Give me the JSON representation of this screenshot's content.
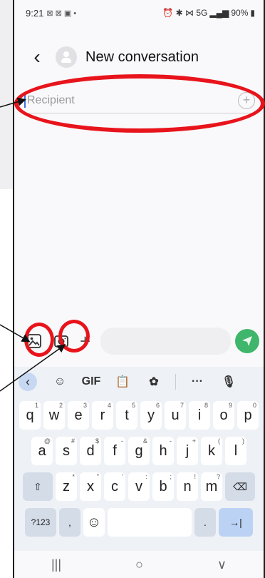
{
  "status_bar": {
    "time": "9:21",
    "notification_icons": "⊠ ⊠ ▣ •",
    "right_icons": "⏰ ✱ ⋈ 5G",
    "battery": "90%"
  },
  "app_bar": {
    "title": "New conversation"
  },
  "recipient": {
    "placeholder": "Recipient",
    "add_label": "+"
  },
  "compose": {
    "plus_label": "+"
  },
  "keyboard": {
    "toolbar": [
      "GIF",
      "···"
    ],
    "row1": [
      {
        "k": "q",
        "h": "1"
      },
      {
        "k": "w",
        "h": "2"
      },
      {
        "k": "e",
        "h": "3"
      },
      {
        "k": "r",
        "h": "4"
      },
      {
        "k": "t",
        "h": "5"
      },
      {
        "k": "y",
        "h": "6"
      },
      {
        "k": "u",
        "h": "7"
      },
      {
        "k": "i",
        "h": "8"
      },
      {
        "k": "o",
        "h": "9"
      },
      {
        "k": "p",
        "h": "0"
      }
    ],
    "row2": [
      {
        "k": "a",
        "h": "@"
      },
      {
        "k": "s",
        "h": "#"
      },
      {
        "k": "d",
        "h": "$"
      },
      {
        "k": "f",
        "h": "-"
      },
      {
        "k": "g",
        "h": "&"
      },
      {
        "k": "h",
        "h": "-"
      },
      {
        "k": "j",
        "h": "+"
      },
      {
        "k": "k",
        "h": "("
      },
      {
        "k": "l",
        "h": ")"
      }
    ],
    "row3": [
      {
        "k": "z",
        "h": "*"
      },
      {
        "k": "x",
        "h": "\""
      },
      {
        "k": "c",
        "h": "'"
      },
      {
        "k": "v",
        "h": ":"
      },
      {
        "k": "b",
        "h": ";"
      },
      {
        "k": "n",
        "h": "!"
      },
      {
        "k": "m",
        "h": "?"
      }
    ],
    "symbols_label": "?123",
    "comma": ",",
    "period": "."
  },
  "nav_bar": {
    "recents": "|||",
    "home": "○",
    "back": "∨"
  },
  "colors": {
    "annotation": "#e8141c",
    "send": "#3fb66b",
    "accent": "#3d6fe2"
  }
}
